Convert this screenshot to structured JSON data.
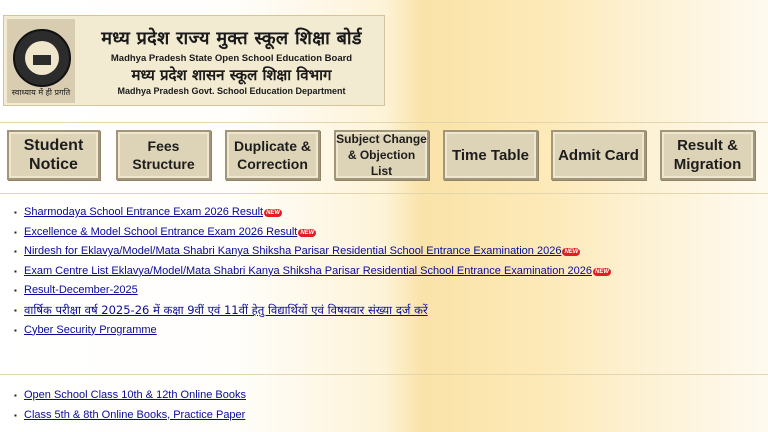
{
  "header": {
    "title_hi": "मध्य प्रदेश राज्य मुक्त स्कूल शिक्षा बोर्ड",
    "title_en": "Madhya Pradesh State Open School Education Board",
    "dept_hi": "मध्य प्रदेश शासन स्कूल शिक्षा विभाग",
    "dept_en": "Madhya Pradesh Govt. School Education Department",
    "logo_text": "स्वाध्याय में ही प्रगति"
  },
  "nav": [
    {
      "line1": "Student",
      "line2": "Notice"
    },
    {
      "line1": "Fees",
      "line2": "Structure"
    },
    {
      "line1": "Duplicate &",
      "line2": "Correction"
    },
    {
      "line1": "Subject Change",
      "line2": "& Objection List"
    },
    {
      "line1": "Time Table",
      "line2": ""
    },
    {
      "line1": "Admit Card",
      "line2": ""
    },
    {
      "line1": "Result &",
      "line2": "Migration"
    }
  ],
  "news": [
    {
      "text": "Sharmodaya School Entrance Exam 2026 Result",
      "badge": "NEW"
    },
    {
      "text": "Excellence & Model School Entrance Exam 2026 Result",
      "badge": "NEW"
    },
    {
      "text": "Nirdesh for Eklavya/Model/Mata Shabri Kanya Shiksha Parisar Residential School Entrance Examination  2026",
      "badge": "NEW"
    },
    {
      "text": "Exam Centre List Eklavya/Model/Mata Shabri Kanya Shiksha Parisar Residential School Entrance Examination  2026",
      "badge": "NEW"
    },
    {
      "text": "Result-December-2025",
      "badge": ""
    },
    {
      "text": "वार्षिक परीक्षा वर्ष 2025-26 में कक्षा 9वीं एवं 11वीं हेतु विद्यार्थियों एवं विषयवार संख्या दर्ज करें",
      "badge": ""
    },
    {
      "text": "Cyber Security Programme",
      "badge": ""
    }
  ],
  "books": [
    {
      "text": "Open School Class 10th & 12th Online Books"
    },
    {
      "text": "Class 5th & 8th Online Books, Practice Paper"
    }
  ]
}
